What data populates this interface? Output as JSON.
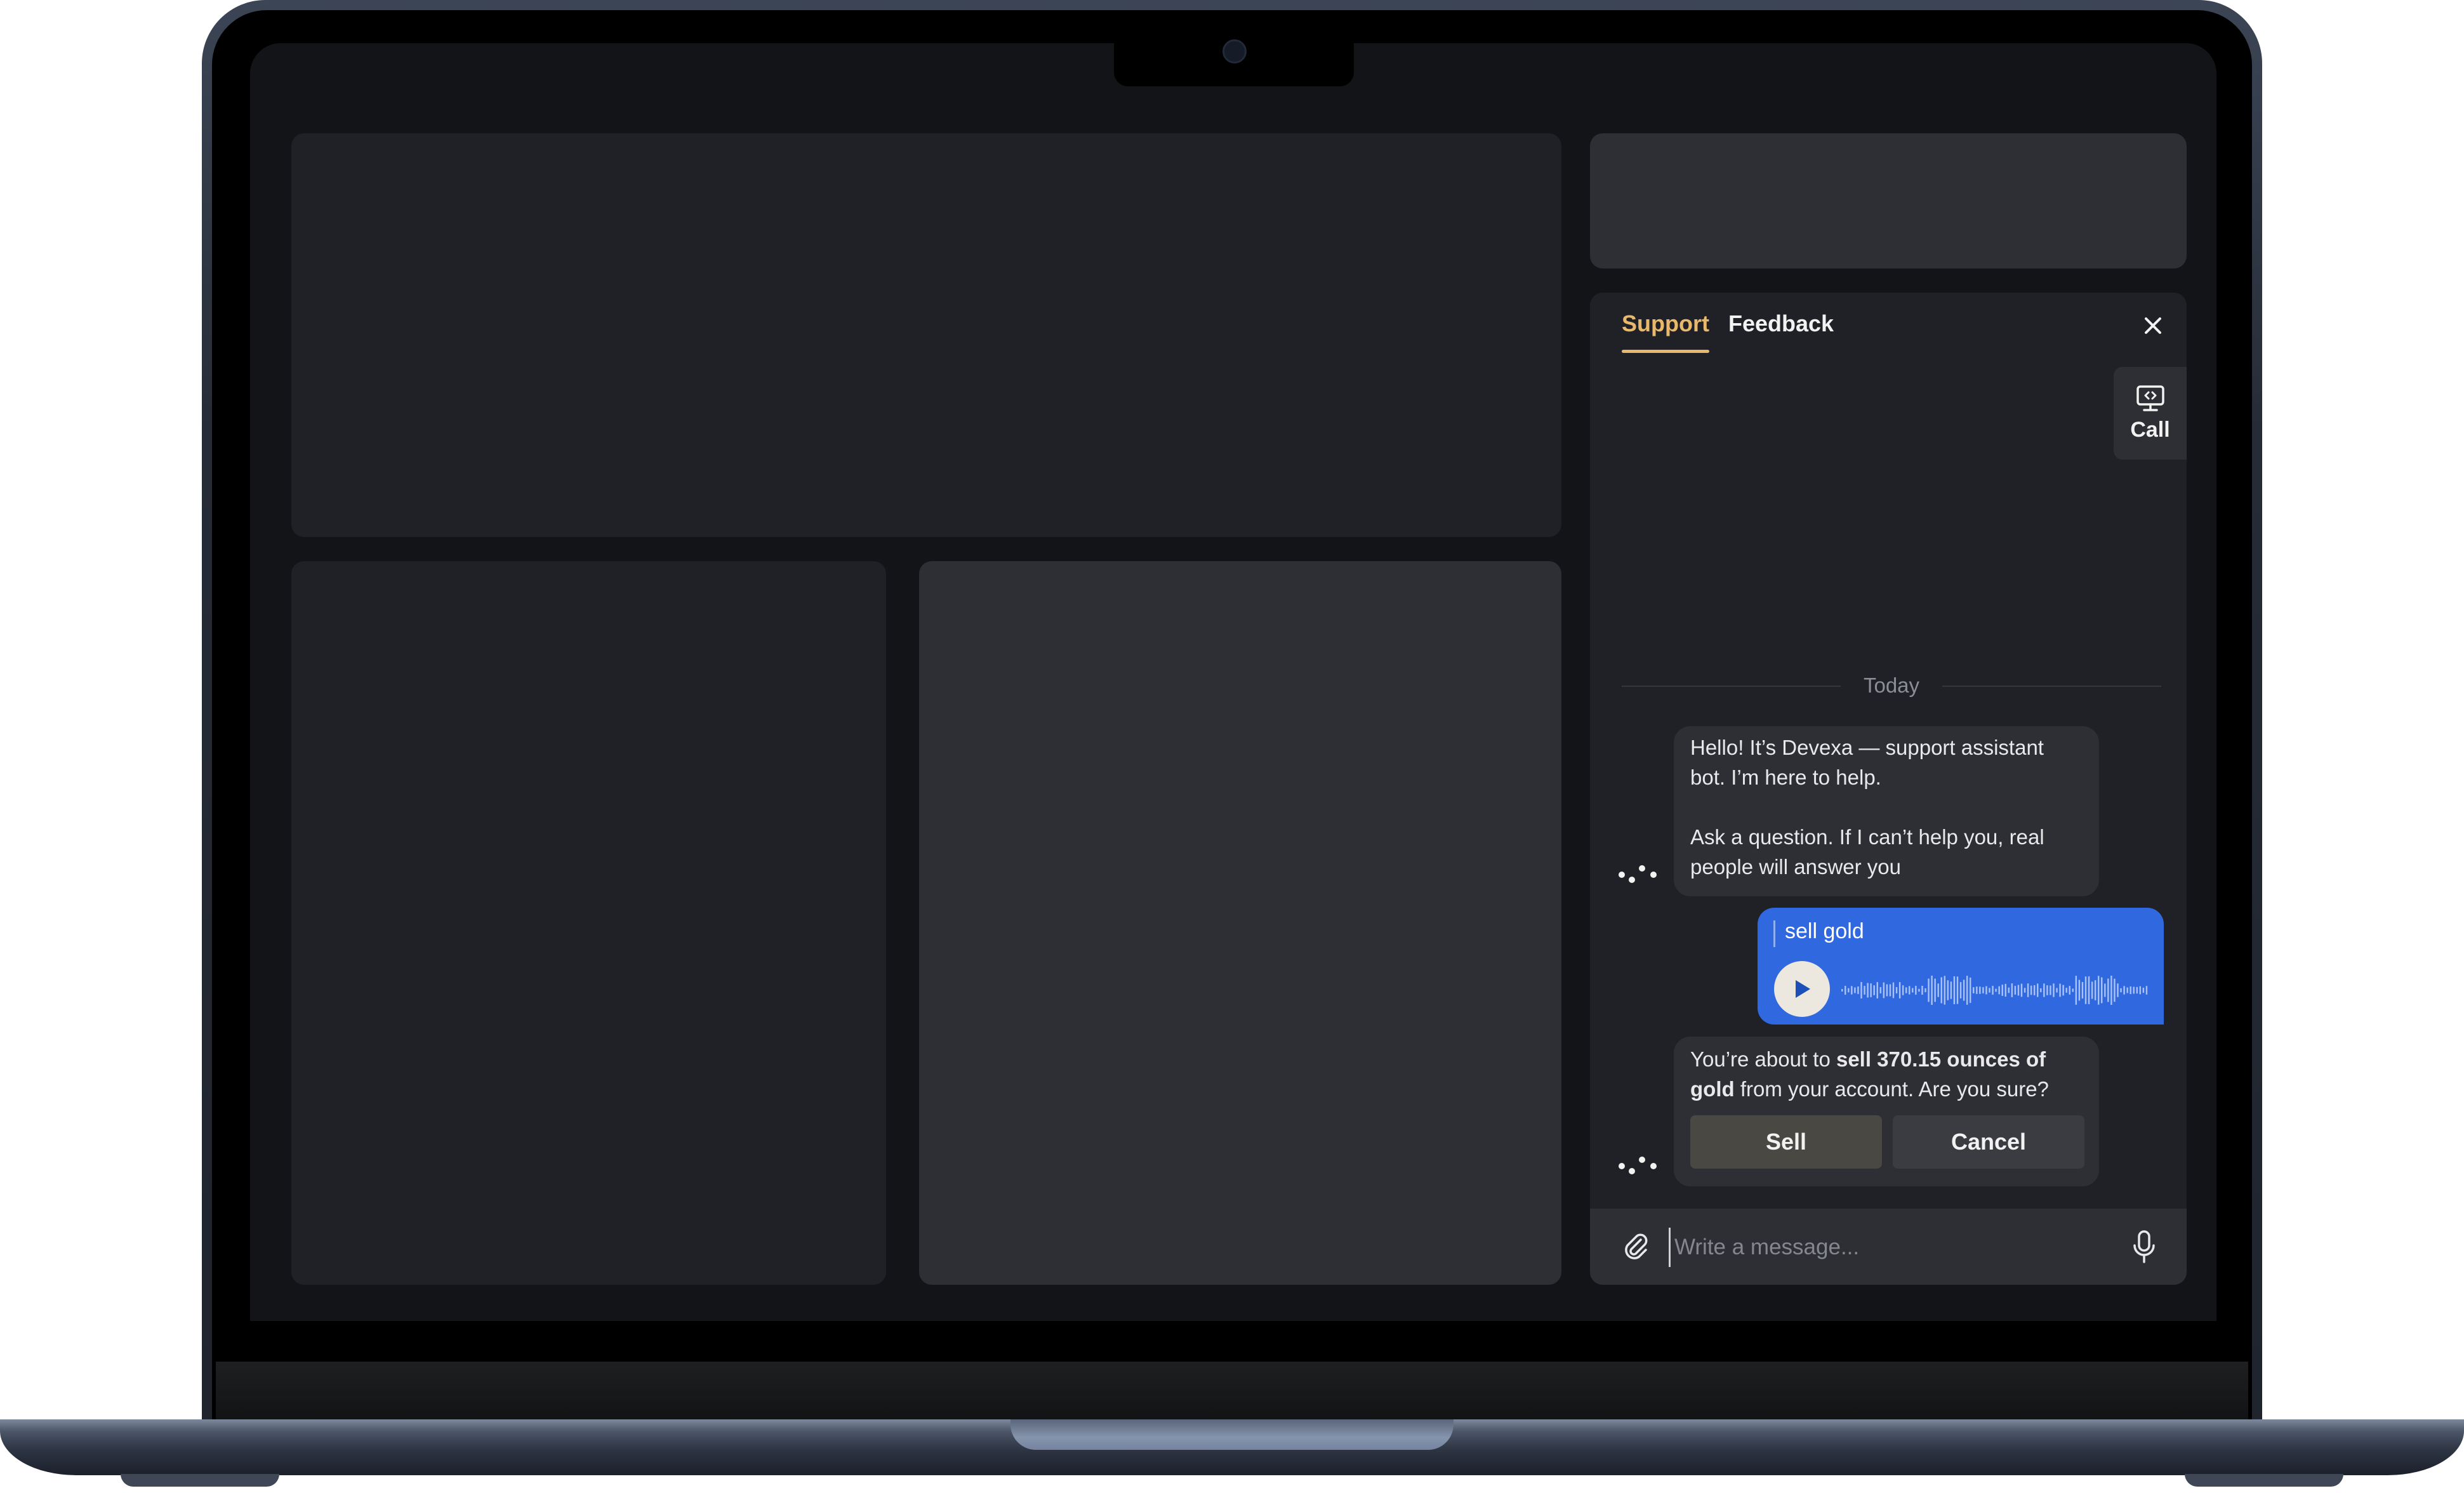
{
  "chat": {
    "tabs": [
      {
        "label": "Support",
        "active": true
      },
      {
        "label": "Feedback",
        "active": false
      }
    ],
    "call_label": "Call",
    "divider_label": "Today",
    "bot_message_1": {
      "line1": "Hello! It’s Devexa — support assistant",
      "line2": "bot. I’m here to help.",
      "line3": "Ask a question. If I can’t help you, real",
      "line4": "people will answer you"
    },
    "user_voice_message": {
      "transcript": "sell gold"
    },
    "bot_message_2": {
      "pre": "You’re about to ",
      "bold1": "sell 370.15 ounces of",
      "bold2": "gold",
      "post": " from your account. Are you sure?",
      "sell_label": "Sell",
      "cancel_label": "Cancel"
    },
    "composer": {
      "placeholder": "Write a message..."
    }
  },
  "colors": {
    "accent": "#e9b96b",
    "user_bubble": "#3068e0",
    "panel": "#202126",
    "bubble": "#2e2f34"
  },
  "icons": [
    "close-icon",
    "screen-share-icon",
    "bot-dots-icon",
    "play-icon",
    "waveform-icon",
    "paperclip-icon",
    "microphone-icon"
  ]
}
